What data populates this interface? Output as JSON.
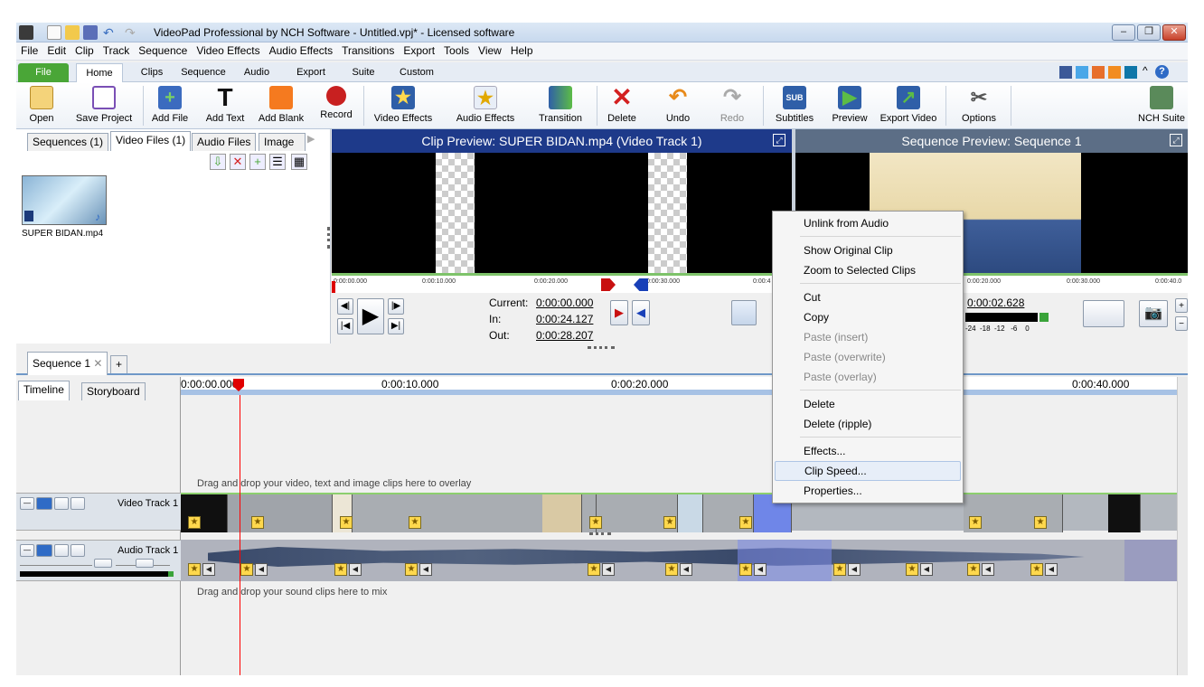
{
  "window": {
    "title": "VideoPad Professional by NCH Software - Untitled.vpj* - Licensed software",
    "controls": [
      "–",
      "❐",
      "✕"
    ]
  },
  "menubar": [
    "File",
    "Edit",
    "Clip",
    "Track",
    "Sequence",
    "Video Effects",
    "Audio Effects",
    "Transitions",
    "Export",
    "Tools",
    "View",
    "Help"
  ],
  "ribbon_tabs": [
    "File",
    "Home",
    "Clips",
    "Sequence",
    "Audio",
    "Export",
    "Suite",
    "Custom"
  ],
  "toolbar": {
    "open": "Open",
    "save_project": "Save Project",
    "add_file": "Add File",
    "add_text": "Add Text",
    "add_blank": "Add Blank",
    "record": "Record",
    "video_effects": "Video Effects",
    "audio_effects": "Audio Effects",
    "transition": "Transition",
    "delete": "Delete",
    "undo": "Undo",
    "redo": "Redo",
    "subtitles": "Subtitles",
    "preview": "Preview",
    "export_video": "Export Video",
    "options": "Options",
    "nch_suite": "NCH Suite",
    "subtitles_icon_text": "SUB"
  },
  "media_tabs": [
    "Sequences (1)",
    "Video Files (1)",
    "Audio Files",
    "Image"
  ],
  "media_file": "SUPER BIDAN.mp4",
  "clip_preview": {
    "title": "Clip Preview: SUPER BIDAN.mp4 (Video Track 1)",
    "ruler": [
      "0:00:00.000",
      "0:00:10.000",
      "0:00:20.000",
      "0:00:30.000",
      "0:00:4"
    ],
    "current_label": "Current:",
    "current": "0:00:00.000",
    "in_label": "In:",
    "in": "0:00:24.127",
    "out_label": "Out:",
    "out": "0:00:28.207"
  },
  "sequence_preview": {
    "title": "Sequence Preview: Sequence 1",
    "ruler": [
      "0:00:20.000",
      "0:00:30.000",
      "0:00:40.0"
    ],
    "time": "0:00:02.628",
    "meter_scale": "-24  -18  -12   -6    0"
  },
  "sequence_tabs": {
    "tab": "Sequence 1",
    "close": "✕",
    "add": "+"
  },
  "timeline": {
    "view_tabs": [
      "Timeline",
      "Storyboard"
    ],
    "ruler": [
      "0:00:00.000",
      "0:00:10.000",
      "0:00:20.000",
      "0:00:40.000"
    ],
    "overlay_hint": "Drag and drop your video, text and image clips here to overlay",
    "video_track": "Video Track 1",
    "audio_track": "Audio Track 1",
    "audio_hint": "Drag and drop your sound clips here to mix"
  },
  "context_menu": {
    "items": [
      "Unlink from Audio",
      "Show Original Clip",
      "Zoom to Selected Clips",
      "Cut",
      "Copy",
      "Paste (insert)",
      "Paste (overwrite)",
      "Paste (overlay)",
      "Delete",
      "Delete (ripple)",
      "Effects...",
      "Clip Speed...",
      "Properties..."
    ]
  },
  "colors": {
    "preview_header": "#1e3a8a",
    "seq_preview_header": "#5c6e86",
    "file_tab": "#4aa637",
    "playhead": "#ff0000",
    "selected_clip": "#6f86e8"
  }
}
